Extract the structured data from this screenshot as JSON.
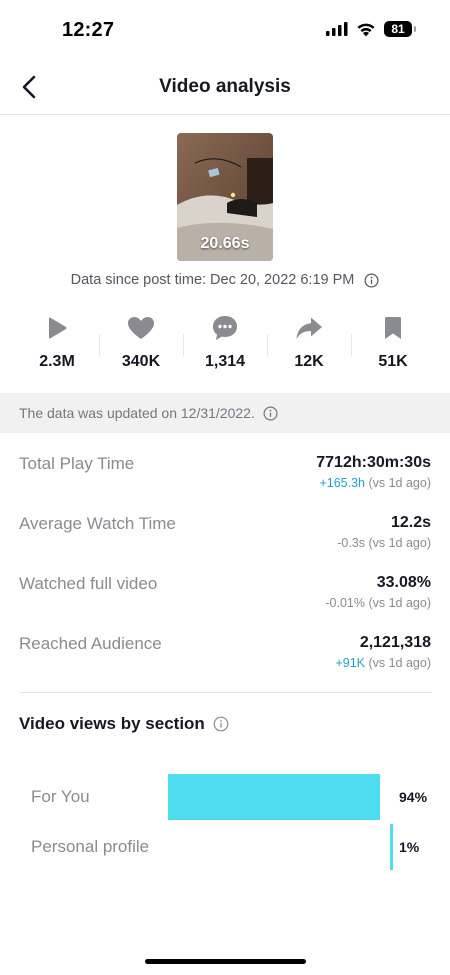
{
  "status_bar": {
    "time": "12:27",
    "battery": "81"
  },
  "nav": {
    "title": "Video analysis"
  },
  "video": {
    "duration": "20.66s"
  },
  "data_since": "Data since post time: Dec 20, 2022 6:19 PM",
  "metrics": [
    {
      "icon": "play-icon",
      "value": "2.3M"
    },
    {
      "icon": "heart-icon",
      "value": "340K"
    },
    {
      "icon": "comment-icon",
      "value": "1,314"
    },
    {
      "icon": "share-icon",
      "value": "12K"
    },
    {
      "icon": "bookmark-icon",
      "value": "51K"
    }
  ],
  "update_notice": "The data was updated on 12/31/2022.",
  "stats": [
    {
      "label": "Total Play Time",
      "value": "7712h:30m:30s",
      "delta": "+165.3h",
      "suffix": "(vs 1d ago)",
      "positive": true
    },
    {
      "label": "Average Watch Time",
      "value": "12.2s",
      "delta": "-0.3s",
      "suffix": "(vs 1d ago)",
      "positive": false
    },
    {
      "label": "Watched full video",
      "value": "33.08%",
      "delta": "-0.01%",
      "suffix": "(vs 1d ago)",
      "positive": false
    },
    {
      "label": "Reached Audience",
      "value": "2,121,318",
      "delta": "+91K",
      "suffix": "(vs 1d ago)",
      "positive": true
    }
  ],
  "views_by_section": {
    "title": "Video views by section",
    "items": [
      {
        "label": "For You",
        "percent": 94,
        "display": "94%"
      },
      {
        "label": "Personal profile",
        "percent": 1,
        "display": "1%"
      }
    ]
  },
  "colors": {
    "accent_bar": "#4ddcf0",
    "positive_delta": "#20a2c8"
  }
}
